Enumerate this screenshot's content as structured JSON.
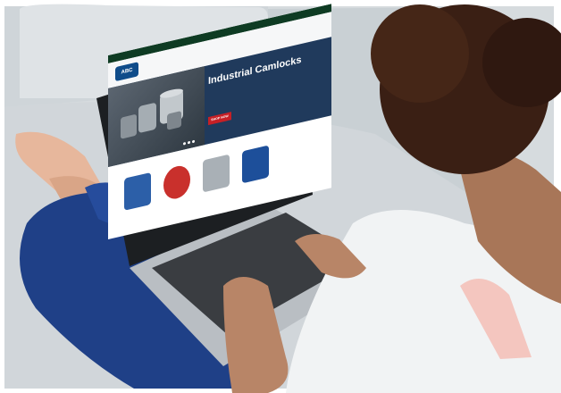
{
  "screen": {
    "topbar_left": "",
    "topbar_right": "",
    "logo_text": "ABC",
    "nav_items": [
      "",
      "",
      "",
      ""
    ],
    "hero_title": "Industrial Camlocks",
    "hero_text": "",
    "hero_button": "SHOP NOW",
    "section_title": ""
  },
  "colors": {
    "topbar": "#0e3b23",
    "hero": "#203a5c",
    "button": "#c62026",
    "sofa": "#d9dde0",
    "jeans": "#1e3f86"
  },
  "icons": [
    "laptop",
    "person",
    "sofa"
  ]
}
